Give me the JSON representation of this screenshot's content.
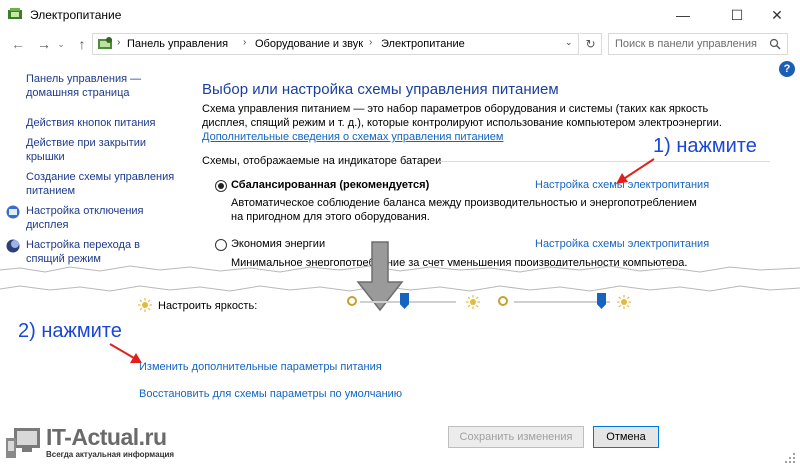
{
  "window": {
    "title": "Электропитание",
    "minimize": "—",
    "maximize": "☐",
    "close": "✕"
  },
  "nav": {
    "back": "←",
    "forward": "→",
    "up": "↑",
    "breadcrumbs": [
      "Панель управления",
      "Оборудование и звук",
      "Электропитание"
    ],
    "refresh": "↻",
    "search_placeholder": "Поиск в панели управления"
  },
  "sidebar": {
    "items": [
      {
        "label": "Панель управления — домашняя страница"
      },
      {
        "label": "Действия кнопок питания"
      },
      {
        "label": "Действие при закрытии крышки"
      },
      {
        "label": "Создание схемы управления питанием"
      },
      {
        "label": "Настройка отключения дисплея"
      },
      {
        "label": "Настройка перехода в спящий режим"
      }
    ]
  },
  "main": {
    "title": "Выбор или настройка схемы управления питанием",
    "description": "Схема управления питанием — это набор параметров оборудования и системы (таких как яркость дисплея, спящий режим и т. д.), которые контролируют использование компьютером электроэнергии.",
    "more_link": "Дополнительные сведения о схемах управления питанием",
    "group_label": "Схемы, отображаемые на индикаторе батареи",
    "plans": [
      {
        "name": "Сбалансированная (рекомендуется)",
        "selected": true,
        "link": "Настройка схемы электропитания",
        "description": "Автоматическое соблюдение баланса между производительностью и энергопотреблением на пригодном для этого оборудования."
      },
      {
        "name": "Экономия энергии",
        "selected": false,
        "link": "Настройка схемы электропитания",
        "description": "Минимальное энергопотребление за счет уменьшения производительности компьютера,"
      }
    ],
    "brightness_label": "Настроить яркость:",
    "bottom_links": [
      {
        "label": "Изменить дополнительные параметры питания"
      },
      {
        "label": "Восстановить для схемы параметры по умолчанию"
      }
    ]
  },
  "annotations": {
    "step1": "1) нажмите",
    "step2": "2) нажмите"
  },
  "buttons": {
    "save": "Сохранить изменения",
    "cancel": "Отмена"
  },
  "watermark": {
    "name": "IT-Actual.ru",
    "tagline": "Всегда актуальная информация"
  },
  "help": "?",
  "colors": {
    "link": "#1565c0",
    "title": "#1b3f9c",
    "annotation": "#1a47d8",
    "arrow": "#e0201b"
  }
}
